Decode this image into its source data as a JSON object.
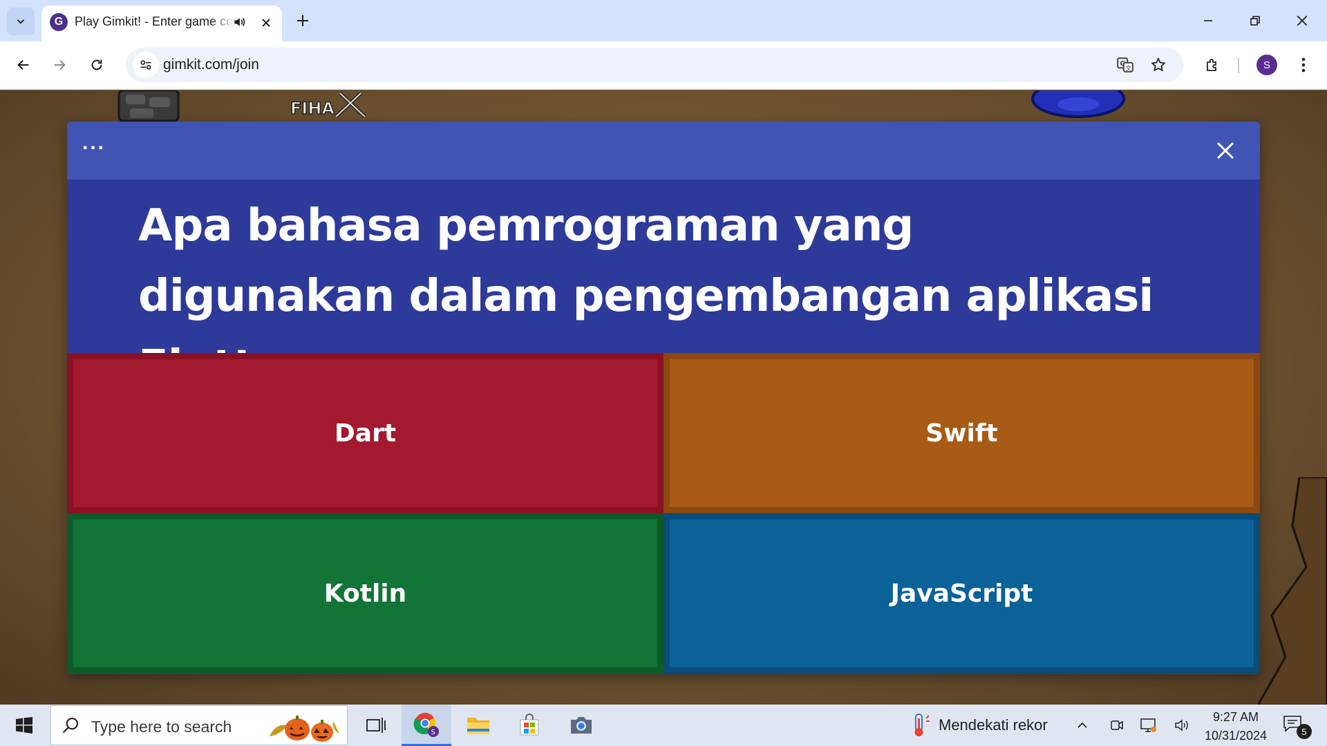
{
  "browser": {
    "tab": {
      "title": "Play Gimkit! - Enter game code",
      "favicon_letter": "G"
    },
    "url": "gimkit.com/join",
    "profile_initial": "S"
  },
  "game": {
    "bg_label": "FIHA"
  },
  "modal": {
    "menu_label": "...",
    "question": "Apa bahasa pemrograman yang digunakan dalam pengembangan aplikasi Flutter ...",
    "answers": [
      {
        "label": "Dart",
        "color": "#a3192f",
        "border": "#8a1124"
      },
      {
        "label": "Swift",
        "color": "#a85a16",
        "border": "#8b4810"
      },
      {
        "label": "Kotlin",
        "color": "#127437",
        "border": "#0d5a29"
      },
      {
        "label": "JavaScript",
        "color": "#0a6299",
        "border": "#084c78"
      }
    ]
  },
  "taskbar": {
    "search_placeholder": "Type here to search",
    "weather_text": "Mendekati rekor",
    "time": "9:27 AM",
    "date": "10/31/2024",
    "notification_count": "5"
  },
  "colors": {
    "modal_header": "#4154b3",
    "modal_body": "#2e3a9a",
    "tabstrip": "#d3e3fd"
  }
}
